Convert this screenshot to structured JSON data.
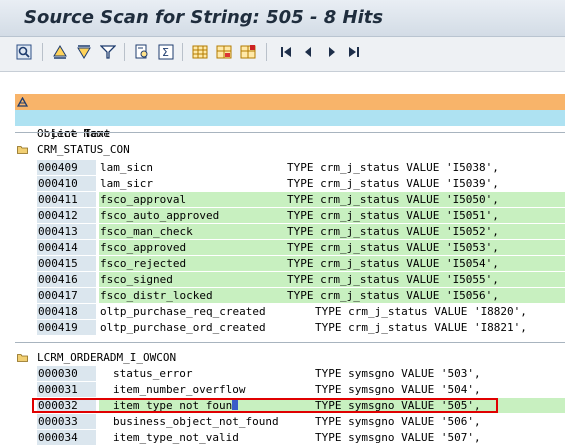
{
  "window": {
    "title": "Source Scan for String: 505 - 8 Hits"
  },
  "toolbar": {
    "buttons": [
      {
        "name": "details-icon",
        "glyph": "🔍"
      },
      {
        "name": "sort-ascending-icon",
        "glyph": "▲"
      },
      {
        "name": "sort-descending-icon",
        "glyph": "▼"
      },
      {
        "name": "filter-icon",
        "glyph": "⧩"
      },
      {
        "name": "print-preview-icon",
        "glyph": "⎙"
      },
      {
        "name": "sum-icon",
        "glyph": "Σ"
      },
      {
        "name": "layout-icon",
        "glyph": "▦"
      },
      {
        "name": "choose-layout-icon",
        "glyph": "⊞"
      },
      {
        "name": "save-layout-icon",
        "glyph": "⊟"
      },
      {
        "name": "first-page-icon",
        "glyph": "⏮"
      },
      {
        "name": "previous-page-icon",
        "glyph": "◀"
      },
      {
        "name": "next-page-icon",
        "glyph": "▶"
      },
      {
        "name": "last-page-icon",
        "glyph": "⏭"
      }
    ]
  },
  "list_header": {
    "line1": "Object Name",
    "line2": "Line Text"
  },
  "groups": [
    {
      "name": "CRM_STATUS_CON",
      "rows": [
        {
          "ln": "000409",
          "a": "lam_sicn",
          "b": "TYPE crm_j_status VALUE 'I5038',",
          "hit": false
        },
        {
          "ln": "000410",
          "a": "lam_sicr",
          "b": "TYPE crm_j_status VALUE 'I5039',",
          "hit": false
        },
        {
          "ln": "000411",
          "a": "fsco_approval",
          "b": "TYPE crm_j_status VALUE 'I5050',",
          "hit": true
        },
        {
          "ln": "000412",
          "a": "fsco_auto_approved",
          "b": "TYPE crm_j_status VALUE 'I5051',",
          "hit": true
        },
        {
          "ln": "000413",
          "a": "fsco_man_check",
          "b": "TYPE crm_j_status VALUE 'I5052',",
          "hit": true
        },
        {
          "ln": "000414",
          "a": "fsco_approved",
          "b": "TYPE crm_j_status VALUE 'I5053',",
          "hit": true
        },
        {
          "ln": "000415",
          "a": "fsco_rejected",
          "b": "TYPE crm_j_status VALUE 'I5054',",
          "hit": true
        },
        {
          "ln": "000416",
          "a": "fsco_signed",
          "b": "TYPE crm_j_status VALUE 'I5055',",
          "hit": true
        },
        {
          "ln": "000417",
          "a": "fsco_distr_locked",
          "b": "TYPE crm_j_status VALUE 'I5056',",
          "hit": true
        },
        {
          "ln": "000418",
          "a": "oltp_purchase_req_created",
          "b": "TYPE crm_j_status VALUE 'I8820',",
          "hit": false
        },
        {
          "ln": "000419",
          "a": "oltp_purchase_ord_created",
          "b": "TYPE crm_j_status VALUE 'I8821',",
          "hit": false
        }
      ]
    },
    {
      "name": "LCRM_ORDERADM_I_OWCON",
      "rows": [
        {
          "ln": "000030",
          "a": "status_error",
          "b": "TYPE symsgno VALUE '503',",
          "hit": false
        },
        {
          "ln": "000031",
          "a": "item_number_overflow",
          "b": "TYPE symsgno VALUE '504',",
          "hit": false
        },
        {
          "ln": "000032",
          "a": "item_type_not_foun",
          "b": "TYPE symsgno VALUE '505',",
          "hit": true
        },
        {
          "ln": "000033",
          "a": "business_object_not_found",
          "b": "TYPE symsgno VALUE '506',",
          "hit": false
        },
        {
          "ln": "000034",
          "a": "item_type_not_valid",
          "b": "TYPE symsgno VALUE '507',",
          "hit": false
        }
      ]
    }
  ],
  "colors": {
    "hit_row": "#c8f0c0",
    "header_orange": "#f8b46a",
    "header_blue": "#aee2f2",
    "highlight_box": "#e00000"
  }
}
